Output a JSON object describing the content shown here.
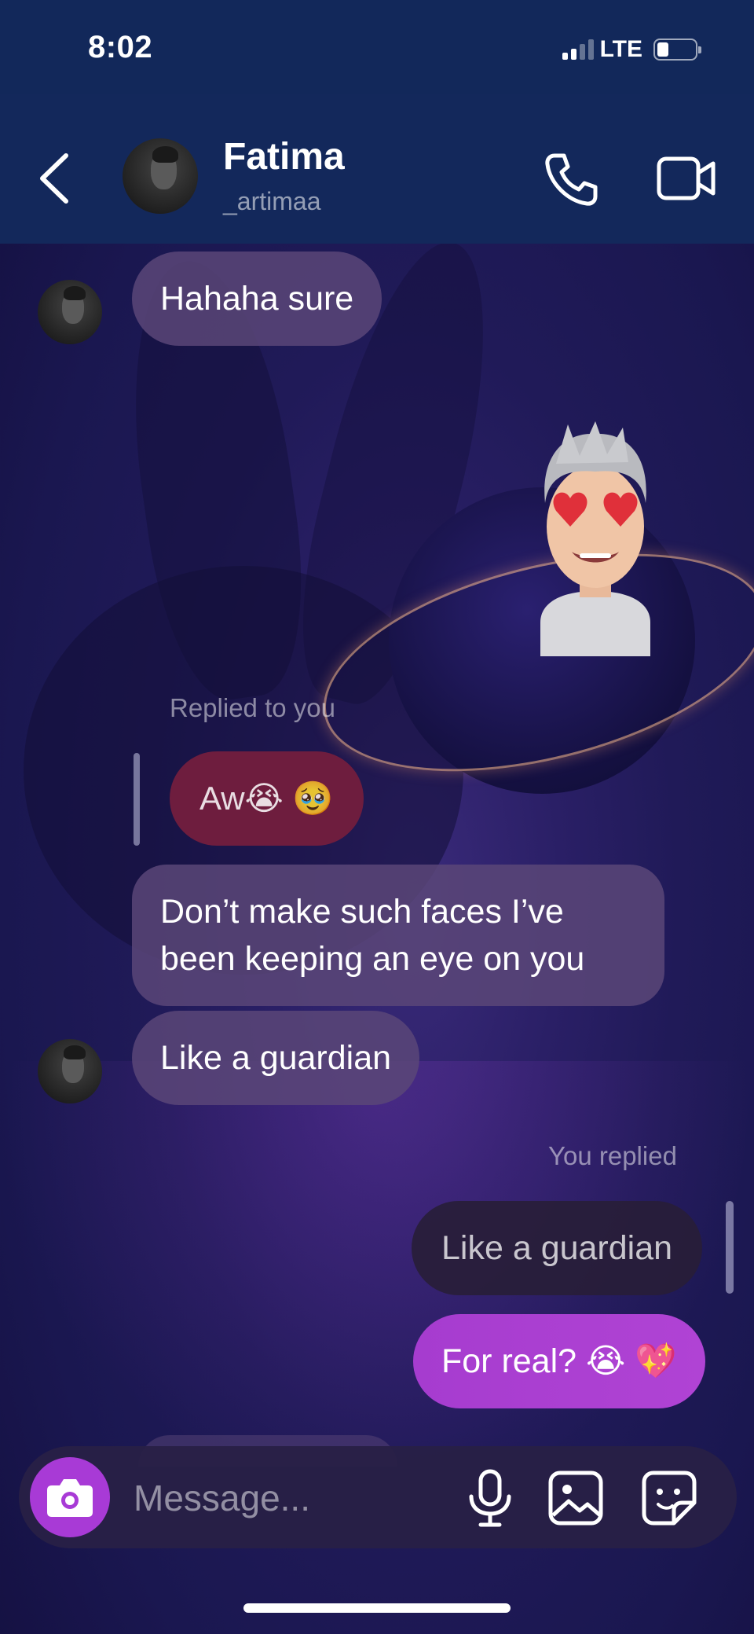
{
  "status_bar": {
    "time": "8:02",
    "network": "LTE"
  },
  "header": {
    "name": "Fatima",
    "username": "_artimaa"
  },
  "messages": {
    "m1": "Hahaha sure",
    "reply_label": "Replied to you",
    "reply_quote": "Aw😭 🥹",
    "m2": "Don’t make such faces I’ve been keeping an eye on you",
    "m3": "Like a guardian",
    "you_replied_label": "You replied",
    "sent_quote": "Like a guardian",
    "sent": "For real? 😭 💖"
  },
  "composer": {
    "placeholder": "Message..."
  },
  "colors": {
    "accent": "#a83ad6",
    "header_bg": "#13285b",
    "reply_quote_bg": "#6e1d3e"
  },
  "icons": [
    "back-icon",
    "phone-icon",
    "video-camera-icon",
    "camera-icon",
    "microphone-icon",
    "gallery-icon",
    "sticker-icon"
  ]
}
